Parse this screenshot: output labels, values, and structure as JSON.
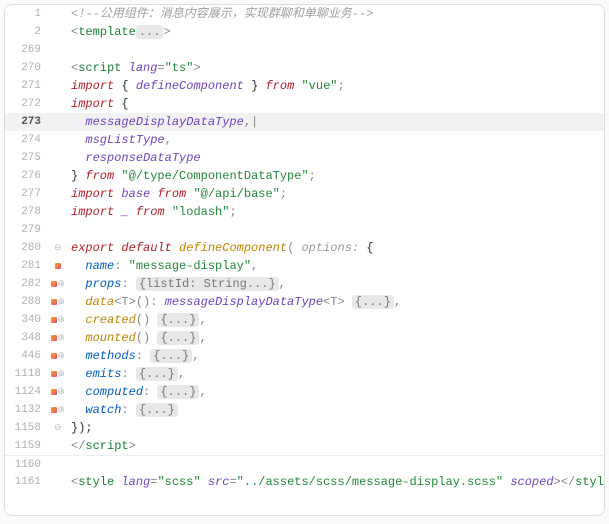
{
  "lines": [
    {
      "n": "1",
      "mark": false,
      "fold": "",
      "hl": false
    },
    {
      "n": "2",
      "mark": false,
      "fold": "",
      "hl": false
    },
    {
      "n": "269",
      "mark": false,
      "fold": "",
      "hl": false
    },
    {
      "n": "270",
      "mark": false,
      "fold": "",
      "hl": false
    },
    {
      "n": "271",
      "mark": false,
      "fold": "",
      "hl": false
    },
    {
      "n": "272",
      "mark": false,
      "fold": "",
      "hl": false
    },
    {
      "n": "273",
      "mark": false,
      "fold": "",
      "hl": true
    },
    {
      "n": "274",
      "mark": false,
      "fold": "",
      "hl": false
    },
    {
      "n": "275",
      "mark": false,
      "fold": "",
      "hl": false
    },
    {
      "n": "276",
      "mark": false,
      "fold": "",
      "hl": false
    },
    {
      "n": "277",
      "mark": false,
      "fold": "",
      "hl": false
    },
    {
      "n": "278",
      "mark": false,
      "fold": "",
      "hl": false
    },
    {
      "n": "279",
      "mark": false,
      "fold": "",
      "hl": false
    },
    {
      "n": "280",
      "mark": false,
      "fold": "⊖",
      "hl": false
    },
    {
      "n": "281",
      "mark": true,
      "fold": "",
      "hl": false
    },
    {
      "n": "282",
      "mark": true,
      "fold": "⊕",
      "hl": false
    },
    {
      "n": "288",
      "mark": true,
      "fold": "⊕",
      "hl": false
    },
    {
      "n": "340",
      "mark": true,
      "fold": "⊕",
      "hl": false
    },
    {
      "n": "348",
      "mark": true,
      "fold": "⊕",
      "hl": false
    },
    {
      "n": "446",
      "mark": true,
      "fold": "⊕",
      "hl": false
    },
    {
      "n": "1118",
      "mark": true,
      "fold": "⊕",
      "hl": false
    },
    {
      "n": "1124",
      "mark": true,
      "fold": "⊕",
      "hl": false
    },
    {
      "n": "1132",
      "mark": true,
      "fold": "⊕",
      "hl": false
    },
    {
      "n": "1158",
      "mark": false,
      "fold": "⊖",
      "hl": false
    },
    {
      "n": "1159",
      "mark": false,
      "fold": "",
      "hl": false
    },
    {
      "n": "1160",
      "mark": false,
      "fold": "",
      "hl": false
    },
    {
      "n": "1161",
      "mark": false,
      "fold": "",
      "hl": false
    }
  ],
  "t": {
    "comment1": "<!--公用组件：消息内容展示，实现群聊和单聊业务-->",
    "template": "template",
    "ellips": "...",
    "script": "script",
    "lang": "lang",
    "ts": "\"ts\"",
    "import": "import",
    "defineComponent": "defineComponent",
    "from": "from",
    "vue": "\"vue\"",
    "messageDisplayDataType": "messageDisplayDataType",
    "msgListType": "msgListType",
    "responseDataType": "responseDataType",
    "componentDataType": "\"@/type/ComponentDataType\"",
    "base": "base",
    "apiBase": "\"@/api/base\"",
    "underscore": "_",
    "lodash": "\"lodash\"",
    "export": "export",
    "default": "default",
    "options": "options: ",
    "name": "name",
    "nameVal": "\"message-display\"",
    "props": "props",
    "propsVal": "{listId: String...}",
    "data": "data",
    "dataGeneric": "<T>",
    "dataParen": "()",
    "dataRet": "messageDisplayDataType",
    "foldBrace": "{...}",
    "created": "created",
    "mounted": "mounted",
    "methods": "methods",
    "emits": "emits",
    "computed": "computed",
    "watch": "watch",
    "closeObj": "});",
    "style": "style",
    "scss": "\"scss\"",
    "src": "src",
    "srcVal": "\"../assets/scss/message-display.scss\"",
    "scoped": "scoped"
  }
}
